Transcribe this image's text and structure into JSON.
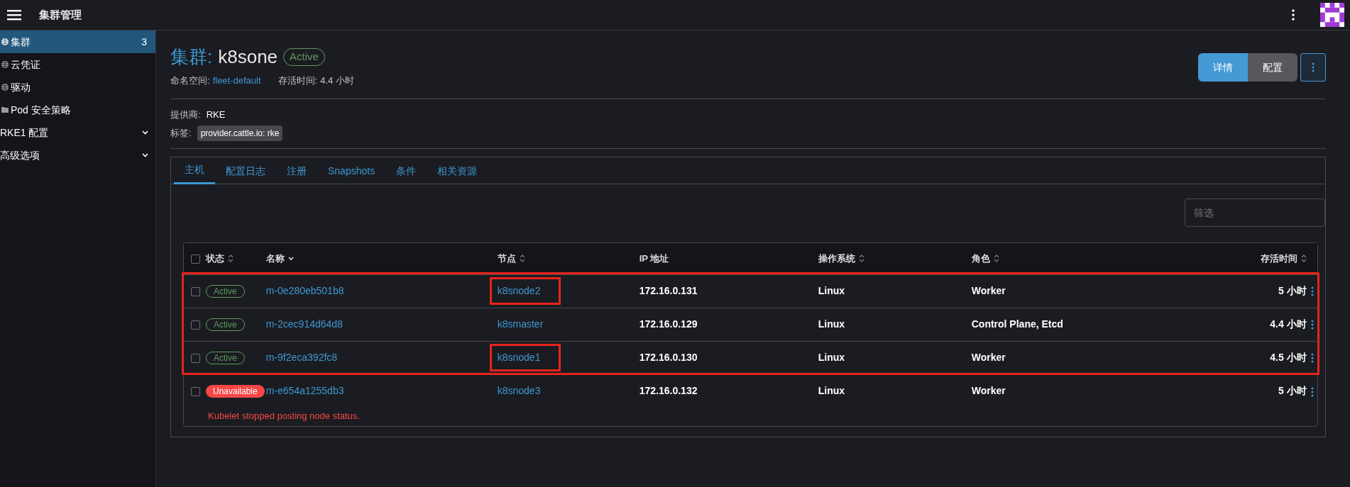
{
  "header": {
    "title": "集群管理"
  },
  "sidebar": {
    "items": [
      {
        "kind": "resource",
        "label": "集群",
        "count": "3",
        "selected": true
      },
      {
        "kind": "resource",
        "label": "云凭证",
        "selected": false
      },
      {
        "kind": "resource",
        "label": "驱动",
        "selected": false
      },
      {
        "kind": "folder",
        "label": "Pod 安全策略",
        "selected": false
      },
      {
        "kind": "group",
        "label": "RKE1 配置",
        "expanded": false
      },
      {
        "kind": "group",
        "label": "高级选项",
        "expanded": false
      }
    ]
  },
  "cluster": {
    "type_label": "集群:",
    "name": "k8sone",
    "state": "Active",
    "namespace_label": "命名空间:",
    "namespace": "fleet-default",
    "age_label": "存活时间:",
    "age": "4.4 小时",
    "provider_label": "提供商:",
    "provider": "RKE",
    "labels_label": "标签:",
    "labels": [
      "provider.cattle.io: rke"
    ]
  },
  "view_buttons": [
    {
      "label": "详情",
      "selected": true
    },
    {
      "label": "配置",
      "selected": false
    }
  ],
  "tabs": [
    {
      "label": "主机",
      "selected": true
    },
    {
      "label": "配置日志",
      "selected": false
    },
    {
      "label": "注册",
      "selected": false
    },
    {
      "label": "Snapshots",
      "selected": false
    },
    {
      "label": "条件",
      "selected": false
    },
    {
      "label": "相关资源",
      "selected": false
    }
  ],
  "filter": {
    "placeholder": "筛选"
  },
  "table": {
    "select_all_checked": false,
    "columns": [
      {
        "label": "状态",
        "kind": "sortable"
      },
      {
        "label": "名称",
        "kind": "sorted"
      },
      {
        "label": "节点",
        "kind": "sortable"
      },
      {
        "label": "IP 地址",
        "kind": "plain"
      },
      {
        "label": "操作系统",
        "kind": "sortable"
      },
      {
        "label": "角色",
        "kind": "sortable"
      },
      {
        "label": "存活时间",
        "kind": "sortable"
      }
    ],
    "rows": [
      {
        "checked": false,
        "state": "Active",
        "kind": "ok",
        "name": "m-0e280eb501b8",
        "node": "k8snode2",
        "ip": "172.16.0.131",
        "os": "Linux",
        "roles": "Worker",
        "age": "5 小时",
        "annotated": true,
        "node_annotated": true
      },
      {
        "checked": false,
        "state": "Active",
        "kind": "ok",
        "name": "m-2cec914d64d8",
        "node": "k8smaster",
        "ip": "172.16.0.129",
        "os": "Linux",
        "roles": "Control Plane, Etcd",
        "age": "4.4 小时",
        "annotated": true,
        "node_annotated": false
      },
      {
        "checked": false,
        "state": "Active",
        "kind": "ok",
        "name": "m-9f2eca392fc8",
        "node": "k8snode1",
        "ip": "172.16.0.130",
        "os": "Linux",
        "roles": "Worker",
        "age": "4.5 小时",
        "annotated": true,
        "node_annotated": true
      },
      {
        "checked": false,
        "state": "Unavailable",
        "kind": "error",
        "name": "m-e654a1255db3",
        "node": "k8snode3",
        "ip": "172.16.0.132",
        "os": "Linux",
        "roles": "Worker",
        "age": "5 小时",
        "annotated": false,
        "node_annotated": false,
        "message": "Kubelet stopped posting node status."
      }
    ]
  }
}
